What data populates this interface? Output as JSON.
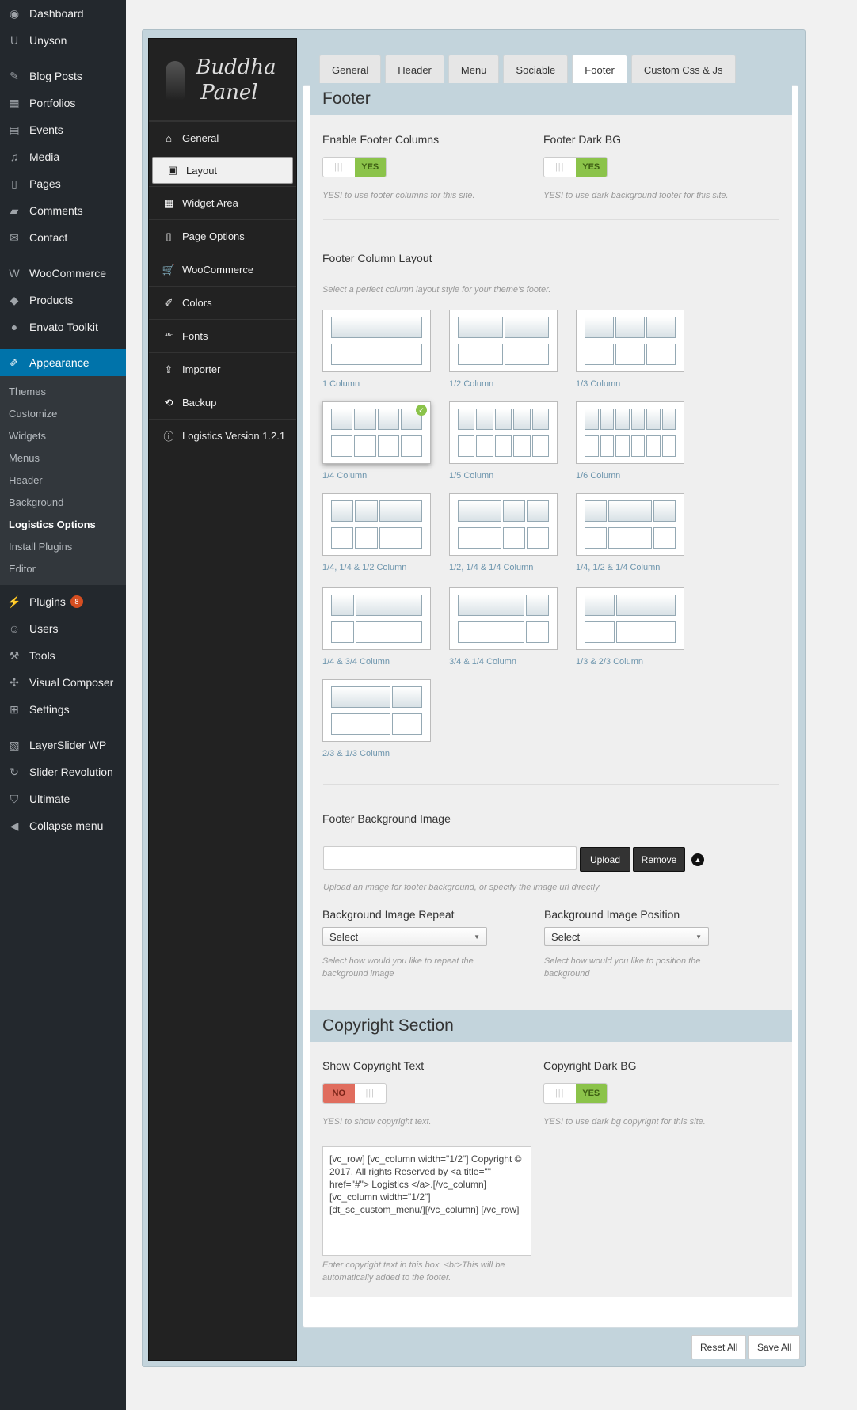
{
  "wp_menu": {
    "items": [
      {
        "label": "Dashboard",
        "icon": "dashboard-icon",
        "glyph": "◉"
      },
      {
        "label": "Unyson",
        "icon": "unyson-icon",
        "glyph": "U"
      },
      {
        "sep": true
      },
      {
        "label": "Blog Posts",
        "icon": "pin-icon",
        "glyph": "✎"
      },
      {
        "label": "Portfolios",
        "icon": "portfolio-icon",
        "glyph": "▦"
      },
      {
        "label": "Events",
        "icon": "calendar-icon",
        "glyph": "▤"
      },
      {
        "label": "Media",
        "icon": "media-icon",
        "glyph": "♫"
      },
      {
        "label": "Pages",
        "icon": "pages-icon",
        "glyph": "▯"
      },
      {
        "label": "Comments",
        "icon": "comment-icon",
        "glyph": "▰"
      },
      {
        "label": "Contact",
        "icon": "mail-icon",
        "glyph": "✉"
      },
      {
        "sep": true
      },
      {
        "label": "WooCommerce",
        "icon": "woo-icon",
        "glyph": "W"
      },
      {
        "label": "Products",
        "icon": "box-icon",
        "glyph": "◆"
      },
      {
        "label": "Envato Toolkit",
        "icon": "leaf-icon",
        "glyph": "●"
      },
      {
        "sep": true
      }
    ],
    "active": {
      "label": "Appearance",
      "icon": "brush-icon",
      "glyph": "✐"
    },
    "sub": [
      "Themes",
      "Customize",
      "Widgets",
      "Menus",
      "Header",
      "Background",
      "Logistics Options",
      "Install Plugins",
      "Editor"
    ],
    "sub_current": "Logistics Options",
    "after": [
      {
        "label": "Plugins",
        "icon": "plugin-icon",
        "glyph": "⚡",
        "badge": "8"
      },
      {
        "label": "Users",
        "icon": "user-icon",
        "glyph": "☺"
      },
      {
        "label": "Tools",
        "icon": "wrench-icon",
        "glyph": "⚒"
      },
      {
        "label": "Visual Composer",
        "icon": "vc-icon",
        "glyph": "✣"
      },
      {
        "label": "Settings",
        "icon": "settings-icon",
        "glyph": "⊞"
      },
      {
        "sep": true
      },
      {
        "label": "LayerSlider WP",
        "icon": "layers-icon",
        "glyph": "▧"
      },
      {
        "label": "Slider Revolution",
        "icon": "refresh-icon",
        "glyph": "↻"
      },
      {
        "label": "Ultimate",
        "icon": "shield-icon",
        "glyph": "⛉"
      },
      {
        "label": "Collapse menu",
        "icon": "collapse-icon",
        "glyph": "◀"
      }
    ]
  },
  "panel": {
    "logo_line1": "Buddha",
    "logo_line2": "Panel",
    "nav": [
      {
        "label": "General",
        "icon": "home-icon",
        "glyph": "⌂"
      },
      {
        "label": "Layout",
        "icon": "layout-icon",
        "glyph": "▣",
        "active": true
      },
      {
        "label": "Widget Area",
        "icon": "widget-icon",
        "glyph": "▦"
      },
      {
        "label": "Page Options",
        "icon": "page-icon",
        "glyph": "▯"
      },
      {
        "label": "WooCommerce",
        "icon": "cart-icon",
        "glyph": "🛒"
      },
      {
        "label": "Colors",
        "icon": "brush-icon",
        "glyph": "✐"
      },
      {
        "label": "Fonts",
        "icon": "fonts-icon",
        "glyph": "ᴬᴮᶜ"
      },
      {
        "label": "Importer",
        "icon": "import-icon",
        "glyph": "⇪"
      },
      {
        "label": "Backup",
        "icon": "history-icon",
        "glyph": "⟲"
      },
      {
        "label": "Logistics Version 1.2.1",
        "icon": "info-icon",
        "glyph": "ⓘ"
      }
    ],
    "tabs": [
      "General",
      "Header",
      "Menu",
      "Sociable",
      "Footer",
      "Custom Css & Js"
    ],
    "active_tab": "Footer"
  },
  "footer": {
    "title": "Footer",
    "enable_cols_label": "Enable Footer Columns",
    "enable_cols_state": "YES",
    "enable_cols_hint": "YES! to use footer columns for this site.",
    "dark_bg_label": "Footer Dark BG",
    "dark_bg_state": "YES",
    "dark_bg_hint": "YES! to use dark background footer for this site.",
    "layout_label": "Footer Column Layout",
    "layout_hint": "Select a perfect column layout style for your theme's footer.",
    "layouts": [
      {
        "caption": "1 Column",
        "cols": [
          1
        ]
      },
      {
        "caption": "1/2 Column",
        "cols": [
          1,
          1
        ]
      },
      {
        "caption": "1/3 Column",
        "cols": [
          1,
          1,
          1
        ]
      },
      {
        "caption": "1/4 Column",
        "cols": [
          1,
          1,
          1,
          1
        ],
        "selected": true
      },
      {
        "caption": "1/5 Column",
        "cols": [
          1,
          1,
          1,
          1,
          1
        ]
      },
      {
        "caption": "1/6 Column",
        "cols": [
          1,
          1,
          1,
          1,
          1,
          1
        ]
      },
      {
        "caption": "1/4, 1/4 & 1/2 Column",
        "cols": [
          1,
          1,
          2
        ]
      },
      {
        "caption": "1/2, 1/4 & 1/4 Column",
        "cols": [
          2,
          1,
          1
        ]
      },
      {
        "caption": "1/4, 1/2 & 1/4 Column",
        "cols": [
          1,
          2,
          1
        ]
      },
      {
        "caption": "1/4 & 3/4 Column",
        "cols": [
          1,
          3
        ]
      },
      {
        "caption": "3/4 & 1/4 Column",
        "cols": [
          3,
          1
        ]
      },
      {
        "caption": "1/3 & 2/3 Column",
        "cols": [
          1,
          2
        ]
      },
      {
        "caption": "2/3 & 1/3 Column",
        "cols": [
          2,
          1
        ]
      }
    ],
    "bg_image_label": "Footer Background Image",
    "bg_image_value": "",
    "upload_label": "Upload",
    "remove_label": "Remove",
    "bg_image_hint": "Upload an image for footer background, or specify the image url directly",
    "repeat_label": "Background Image Repeat",
    "repeat_value": "Select",
    "repeat_hint": "Select how would you like to repeat the background image",
    "position_label": "Background Image Position",
    "position_value": "Select",
    "position_hint": "Select how would you like to position the background"
  },
  "copyright": {
    "title": "Copyright Section",
    "show_label": "Show Copyright Text",
    "show_state": "NO",
    "show_hint": "YES! to show copyright text.",
    "dark_label": "Copyright Dark BG",
    "dark_state": "YES",
    "dark_hint": "YES! to use dark bg copyright for this site.",
    "text": "[vc_row] [vc_column width=\"1/2\"] Copyright © 2017. All rights Reserved by <a title=\"\" href=\"#\"> Logistics </a>.[/vc_column] [vc_column width=\"1/2\"] [dt_sc_custom_menu/][/vc_column] [/vc_row]",
    "text_hint": "Enter copyright text in this box. <br>This will be automatically added to the footer."
  },
  "actions": {
    "reset": "Reset All",
    "save": "Save All"
  }
}
